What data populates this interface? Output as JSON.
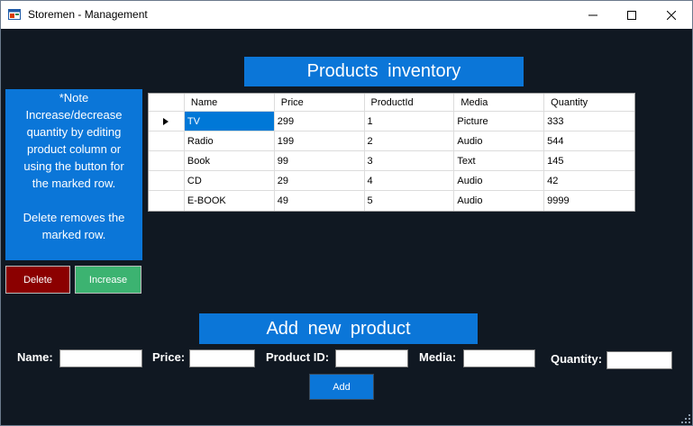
{
  "window": {
    "title": "Storemen - Management",
    "controls": {
      "minimize": "minimize-icon",
      "maximize": "maximize-icon",
      "close": "close-icon"
    }
  },
  "colors": {
    "background": "#101822",
    "accent_blue": "#0b76d8",
    "delete_red": "#8b0000",
    "increase_green": "#3cb371",
    "selected_cell": "#0078d7"
  },
  "inventory": {
    "title": "Products  inventory"
  },
  "note": {
    "lines": [
      "*Note",
      "Increase/decrease",
      "quantity by editing",
      "product column or",
      "using the button for",
      "the marked row."
    ],
    "lines2": [
      "Delete removes the",
      "marked row."
    ]
  },
  "buttons": {
    "delete": "Delete",
    "increase": "Increase",
    "add": "Add"
  },
  "table": {
    "columns": [
      "Name",
      "Price",
      "ProductId",
      "Media",
      "Quantity"
    ],
    "rows": [
      [
        "TV",
        "299",
        "1",
        "Picture",
        "333"
      ],
      [
        "Radio",
        "199",
        "2",
        "Audio",
        "544"
      ],
      [
        "Book",
        "99",
        "3",
        "Text",
        "145"
      ],
      [
        "CD",
        "29",
        "4",
        "Audio",
        "42"
      ],
      [
        "E-BOOK",
        "49",
        "5",
        "Audio",
        "9999"
      ]
    ],
    "selected_row": 0
  },
  "add_form": {
    "title": "Add  new  product",
    "name_label": "Name:",
    "price_label": "Price:",
    "productid_label": "Product ID:",
    "media_label": "Media:",
    "quantity_label": "Quantity:",
    "name_value": "",
    "price_value": "",
    "productid_value": "",
    "media_value": "",
    "quantity_value": ""
  }
}
